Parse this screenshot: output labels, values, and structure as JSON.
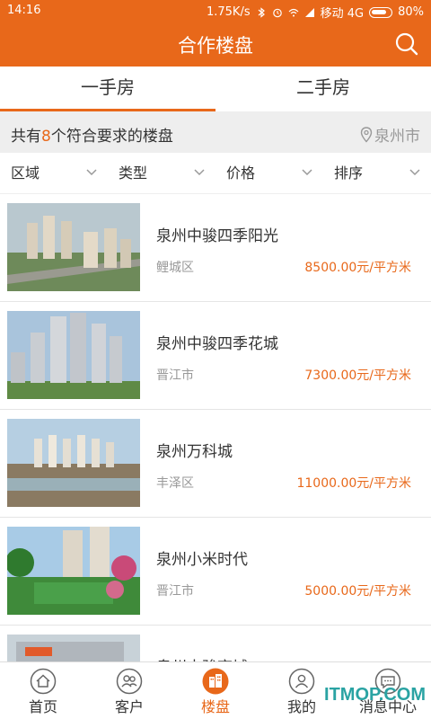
{
  "status_bar": {
    "time": "14:16",
    "speed": "1.75K/s",
    "carrier": "移动 4G",
    "battery": "80%"
  },
  "header": {
    "title": "合作楼盘",
    "search_icon": "search-icon"
  },
  "tabs": [
    {
      "label": "一手房",
      "active": true
    },
    {
      "label": "二手房",
      "active": false
    }
  ],
  "summary": {
    "prefix": "共有",
    "count": "8",
    "suffix": "个符合要求的楼盘",
    "city": "泉州市"
  },
  "filters": [
    {
      "label": "区域"
    },
    {
      "label": "类型"
    },
    {
      "label": "价格"
    },
    {
      "label": "排序"
    }
  ],
  "listings": [
    {
      "name": "泉州中骏四季阳光",
      "district": "鲤城区",
      "price": "8500.00元/平方米"
    },
    {
      "name": "泉州中骏四季花城",
      "district": "晋江市",
      "price": "7300.00元/平方米"
    },
    {
      "name": "泉州万科城",
      "district": "丰泽区",
      "price": "11000.00元/平方米"
    },
    {
      "name": "泉州小米时代",
      "district": "晋江市",
      "price": "5000.00元/平方米"
    },
    {
      "name": "泉州中骏商城",
      "district": "",
      "price": ""
    }
  ],
  "bottom_nav": [
    {
      "label": "首页",
      "icon": "home-icon",
      "active": false
    },
    {
      "label": "客户",
      "icon": "customers-icon",
      "active": false
    },
    {
      "label": "楼盘",
      "icon": "buildings-icon",
      "active": true
    },
    {
      "label": "我的",
      "icon": "profile-icon",
      "active": false
    },
    {
      "label": "消息中心",
      "icon": "message-icon",
      "active": false
    }
  ],
  "watermark": "ITMOP.COM",
  "colors": {
    "accent": "#e8681a",
    "muted": "#999999",
    "summary_bg": "#eeeeee"
  }
}
